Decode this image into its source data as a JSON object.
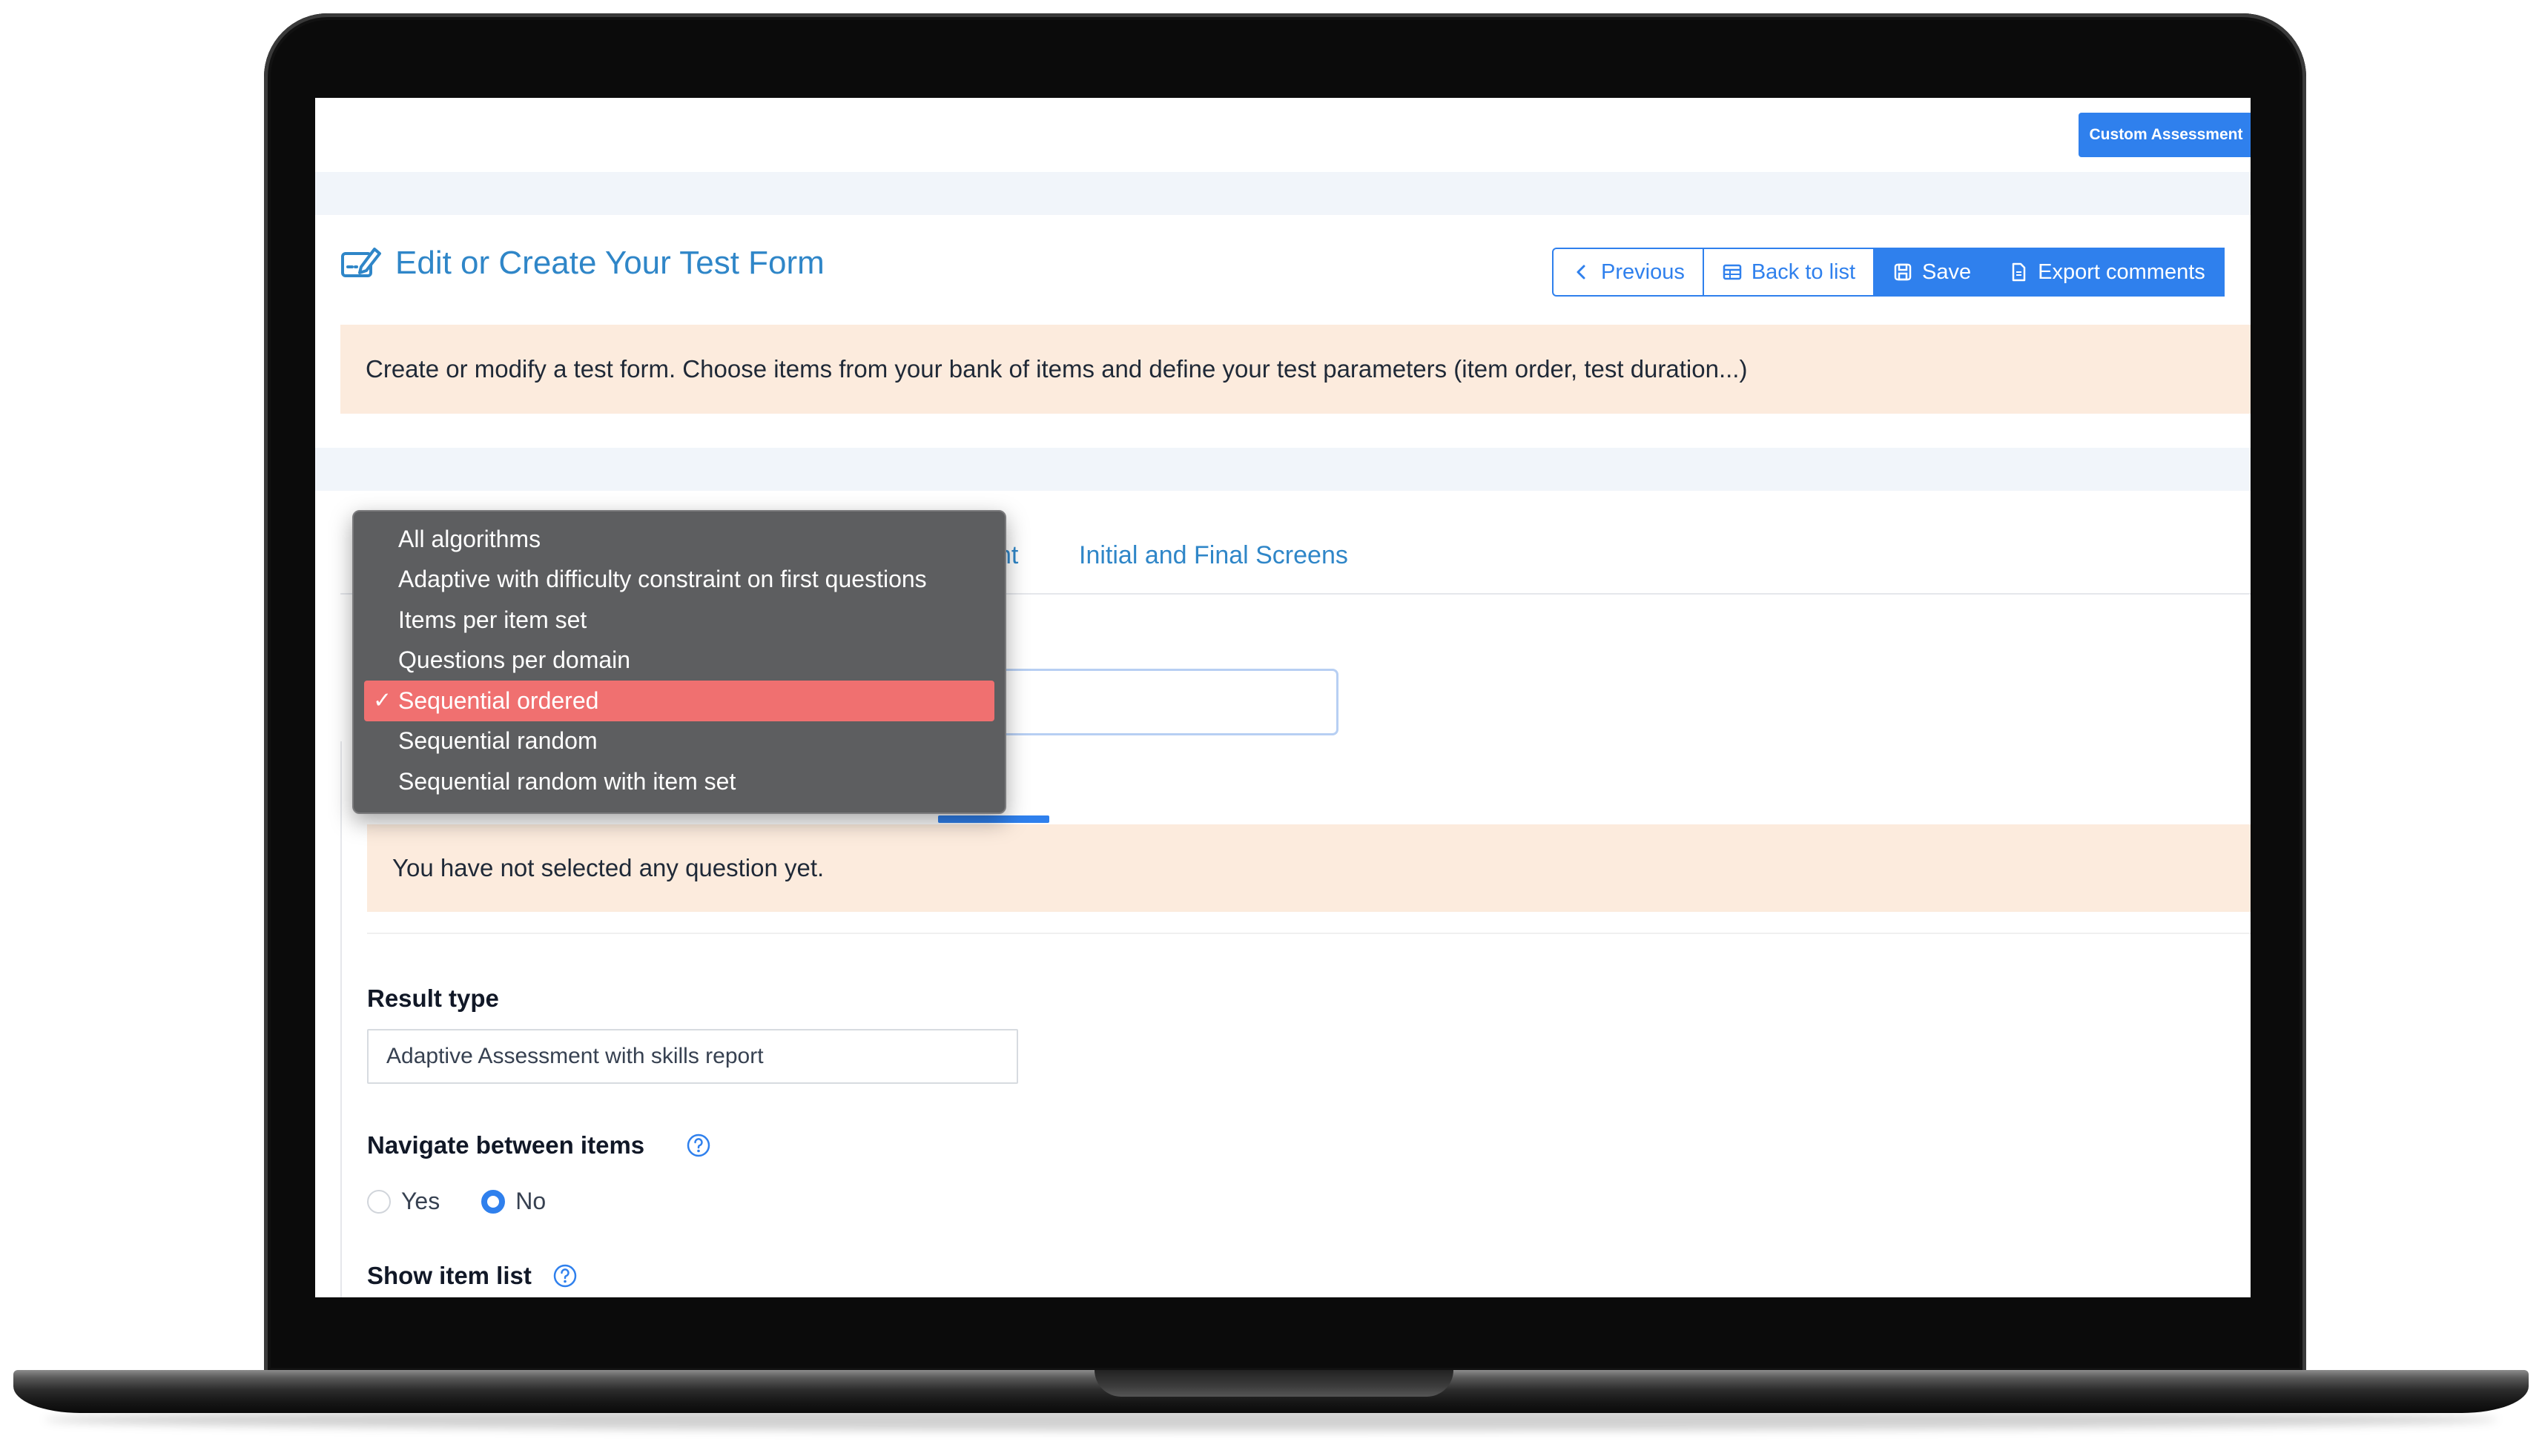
{
  "header": {
    "custom_button": "Custom Assessment"
  },
  "page": {
    "title": "Edit or Create Your Test Form",
    "description": "Create or modify a test form. Choose items from your bank of items and define your test parameters (item order, test duration...)"
  },
  "toolbar": {
    "previous": "Previous",
    "back_to_list": "Back to list",
    "save": "Save",
    "export_comments": "Export comments"
  },
  "tabs": {
    "partial_label": "nt",
    "initial_final": "Initial and Final Screens"
  },
  "algorithm_dropdown": {
    "options": [
      "All algorithms",
      "Adaptive with difficulty constraint on first questions",
      "Items per item set",
      "Questions per domain",
      "Sequential ordered",
      "Sequential random",
      "Sequential random with item set"
    ],
    "selected_index": 4,
    "check_mark": "✓"
  },
  "questions": {
    "empty_message": "You have not selected any question yet."
  },
  "result_type": {
    "label": "Result type",
    "value": "Adaptive Assessment with skills report"
  },
  "navigate": {
    "label": "Navigate between items",
    "options": [
      "Yes",
      "No"
    ],
    "selected": "No"
  },
  "show_item_list": {
    "label": "Show item list"
  },
  "colors": {
    "accent": "#2f80ed",
    "title": "#2f86c8",
    "banner": "#fcebdd",
    "dropdown_bg": "#5d5e60",
    "dropdown_selected": "#f07070"
  }
}
